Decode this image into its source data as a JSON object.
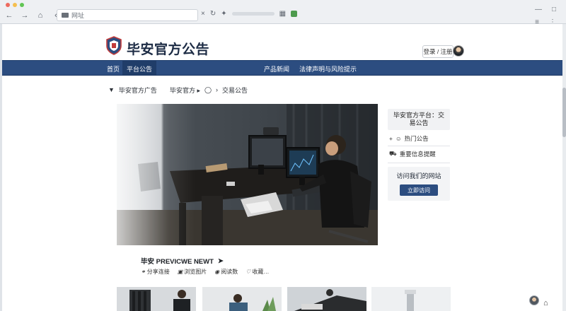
{
  "browser": {
    "traffic_colors": [
      "#ed6a5e",
      "#f5bf4f",
      "#61c554"
    ],
    "nav_icons": [
      "back-icon",
      "forward-icon",
      "home-icon",
      "chevron-left-icon"
    ],
    "address_text": "网址",
    "toolbar_icons": [
      "close-icon",
      "reload-icon",
      "extension-icon",
      "bookmark-icon",
      "sync-icon"
    ]
  },
  "site": {
    "title": "毕安官方公告",
    "login_label": "登录 / 注册",
    "brand_color": "#2c4d80"
  },
  "nav": {
    "items": [
      {
        "label": "首页"
      },
      {
        "label": "平台公告"
      },
      {
        "label": "产品新闻"
      },
      {
        "label": "法律声明与风险提示"
      }
    ]
  },
  "breadcrumb": {
    "items": [
      "毕安官方广告",
      "毕安官方 ▸",
      "交易公告"
    ]
  },
  "sidebar": {
    "top_box": "毕安官方平台：交易公告",
    "row1": "热门公告",
    "row2": "重要信息提醒",
    "card_title": "访问我们的网站",
    "card_button": "立即访问"
  },
  "article": {
    "title": "毕安 PREVICWE NEWT",
    "meta": [
      {
        "icon": "link-icon",
        "label": "分享连接"
      },
      {
        "icon": "image-icon",
        "label": "浏览图片"
      },
      {
        "icon": "eye-icon",
        "label": "阅读数"
      },
      {
        "icon": "heart-icon",
        "label": "收藏…"
      }
    ]
  }
}
